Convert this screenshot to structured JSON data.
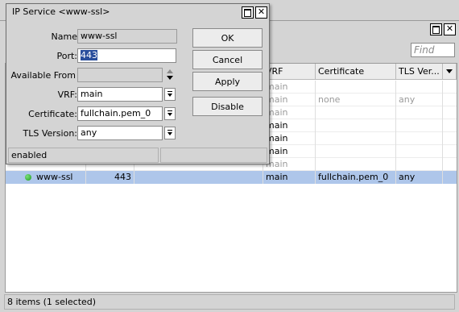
{
  "list_window": {
    "find_placeholder": "Find",
    "columns": [
      {
        "key": "name",
        "label": ""
      },
      {
        "key": "port",
        "label": ""
      },
      {
        "key": "available_from",
        "label": ""
      },
      {
        "key": "vrf",
        "label": "VRF"
      },
      {
        "key": "certificate",
        "label": "Certificate"
      },
      {
        "key": "tls_version",
        "label": "TLS Ver..."
      }
    ],
    "rows": [
      {
        "name": "",
        "port": "",
        "available_from": "",
        "vrf": "main",
        "certificate": "",
        "tls_version": "",
        "style": "dim"
      },
      {
        "name": "",
        "port": "",
        "available_from": "",
        "vrf": "main",
        "certificate": "none",
        "tls_version": "any",
        "style": "dim"
      },
      {
        "name": "",
        "port": "",
        "available_from": "",
        "vrf": "main",
        "certificate": "",
        "tls_version": "",
        "style": "dim"
      },
      {
        "name": "",
        "port": "",
        "available_from": "",
        "vrf": "main",
        "certificate": "",
        "tls_version": "",
        "style": "bold"
      },
      {
        "name": "",
        "port": "",
        "available_from": "",
        "vrf": "main",
        "certificate": "",
        "tls_version": "",
        "style": "bold"
      },
      {
        "name": "",
        "port": "",
        "available_from": "",
        "vrf": "main",
        "certificate": "",
        "tls_version": "",
        "style": "bold"
      },
      {
        "name": "",
        "port": "",
        "available_from": "",
        "vrf": "main",
        "certificate": "",
        "tls_version": "",
        "style": "dim"
      },
      {
        "name": "www-ssl",
        "port": "443",
        "available_from": "",
        "vrf": "main",
        "certificate": "fullchain.pem_0",
        "tls_version": "any",
        "style": "selected"
      }
    ],
    "status": "8 items (1 selected)"
  },
  "dialog": {
    "title": "IP Service <www-ssl>",
    "labels": {
      "name": "Name",
      "port": "Port:",
      "available_from": "Available From",
      "vrf": "VRF:",
      "certificate": "Certificate:",
      "tls_version": "TLS Version:"
    },
    "values": {
      "name": "www-ssl",
      "port": "443",
      "available_from": "",
      "vrf": "main",
      "certificate": "fullchain.pem_0",
      "tls_version": "any"
    },
    "buttons": {
      "ok": "OK",
      "cancel": "Cancel",
      "apply": "Apply",
      "disable": "Disable"
    },
    "status": "enabled"
  },
  "colors": {
    "selection": "#aec6ea",
    "window_bg": "#d4d4d4",
    "status_dot": "#1d9a1d"
  }
}
